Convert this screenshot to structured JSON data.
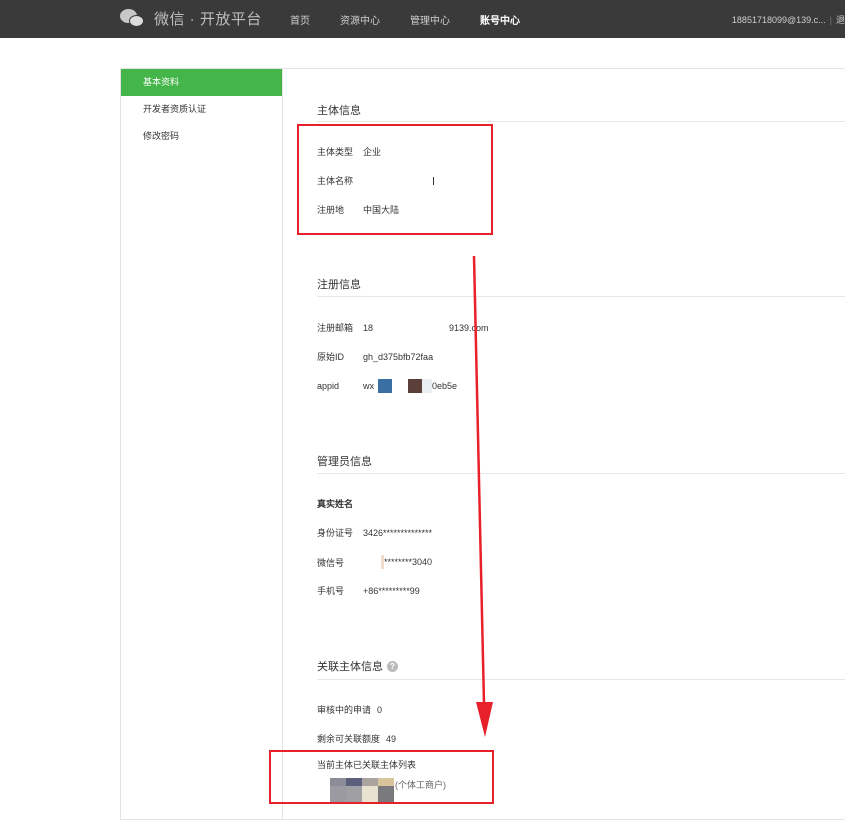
{
  "topbar": {
    "logo_text": "微信 · 开放平台",
    "nav": [
      "首页",
      "资源中心",
      "管理中心",
      "账号中心"
    ],
    "user_email": "18851718099@139.c...",
    "user_extra": "退"
  },
  "sidebar": {
    "items": [
      "基本资料",
      "开发者资质认证",
      "修改密码"
    ]
  },
  "main": {
    "entity": {
      "title": "主体信息",
      "type_label": "主体类型",
      "type_value": "企业",
      "name_label": "主体名称",
      "name_value": "",
      "region_label": "注册地",
      "region_value": "中国大陆"
    },
    "registration": {
      "title": "注册信息",
      "email_label": "注册邮箱",
      "email_prefix": "18",
      "email_suffix": "9139.com",
      "origid_label": "原始ID",
      "origid_value": "gh_d375bfb72faa",
      "appid_label": "appid",
      "appid_prefix": "wx",
      "appid_suffix": "0eb5e"
    },
    "admin": {
      "title": "管理员信息",
      "realname_label": "真实姓名",
      "idcard_label": "身份证号",
      "idcard_value": "3426**************",
      "wechat_label": "微信号",
      "wechat_value": "********3040",
      "phone_label": "手机号",
      "phone_value": "+86*********99"
    },
    "linked": {
      "title": "关联主体信息",
      "help": "?",
      "pending_label": "审核中的申请",
      "pending_value": "0",
      "quota_label": "剩余可关联额度",
      "quota_value": "49",
      "list_label": "当前主体已关联主体列表",
      "list_item_suffix": "(个体工商户)"
    }
  },
  "colors": {
    "topbar": "#3a3a3a",
    "accent": "#44b549",
    "annotation": "#e8202a"
  }
}
